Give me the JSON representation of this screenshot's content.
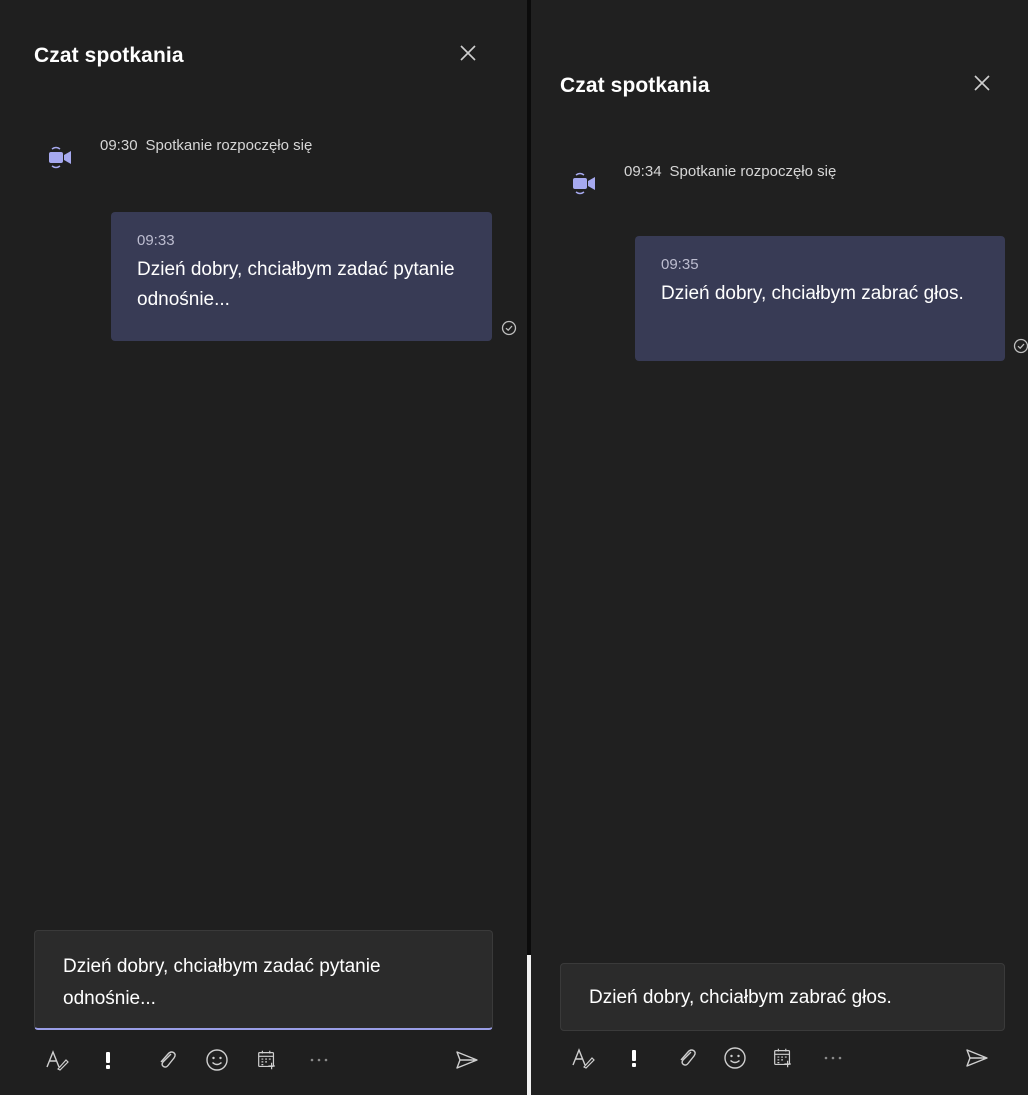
{
  "left_panel": {
    "title": "Czat spotkania",
    "event": {
      "time": "09:30",
      "text": "Spotkanie rozpoczęło się"
    },
    "message": {
      "time": "09:33",
      "text": "Dzień dobry, chciałbym zadać pytanie odnośnie..."
    },
    "compose": {
      "value": "Dzień dobry, chciałbym zadać pytanie odnośnie..."
    }
  },
  "right_panel": {
    "title": "Czat spotkania",
    "event": {
      "time": "09:34",
      "text": "Spotkanie rozpoczęło się"
    },
    "message": {
      "time": "09:35",
      "text": "Dzień dobry, chciałbym zabrać głos."
    },
    "compose": {
      "value": "Dzień dobry, chciałbym zabrać głos."
    }
  },
  "toolbar_icons": [
    "format-icon",
    "important-icon",
    "attach-icon",
    "emoji-icon",
    "schedule-icon",
    "more-icon",
    "send-icon"
  ],
  "colors": {
    "panel_bg": "#1f1f1f",
    "bubble_bg": "#383b55",
    "accent": "#9a9ee6",
    "compose_bg": "#2b2b2b"
  }
}
